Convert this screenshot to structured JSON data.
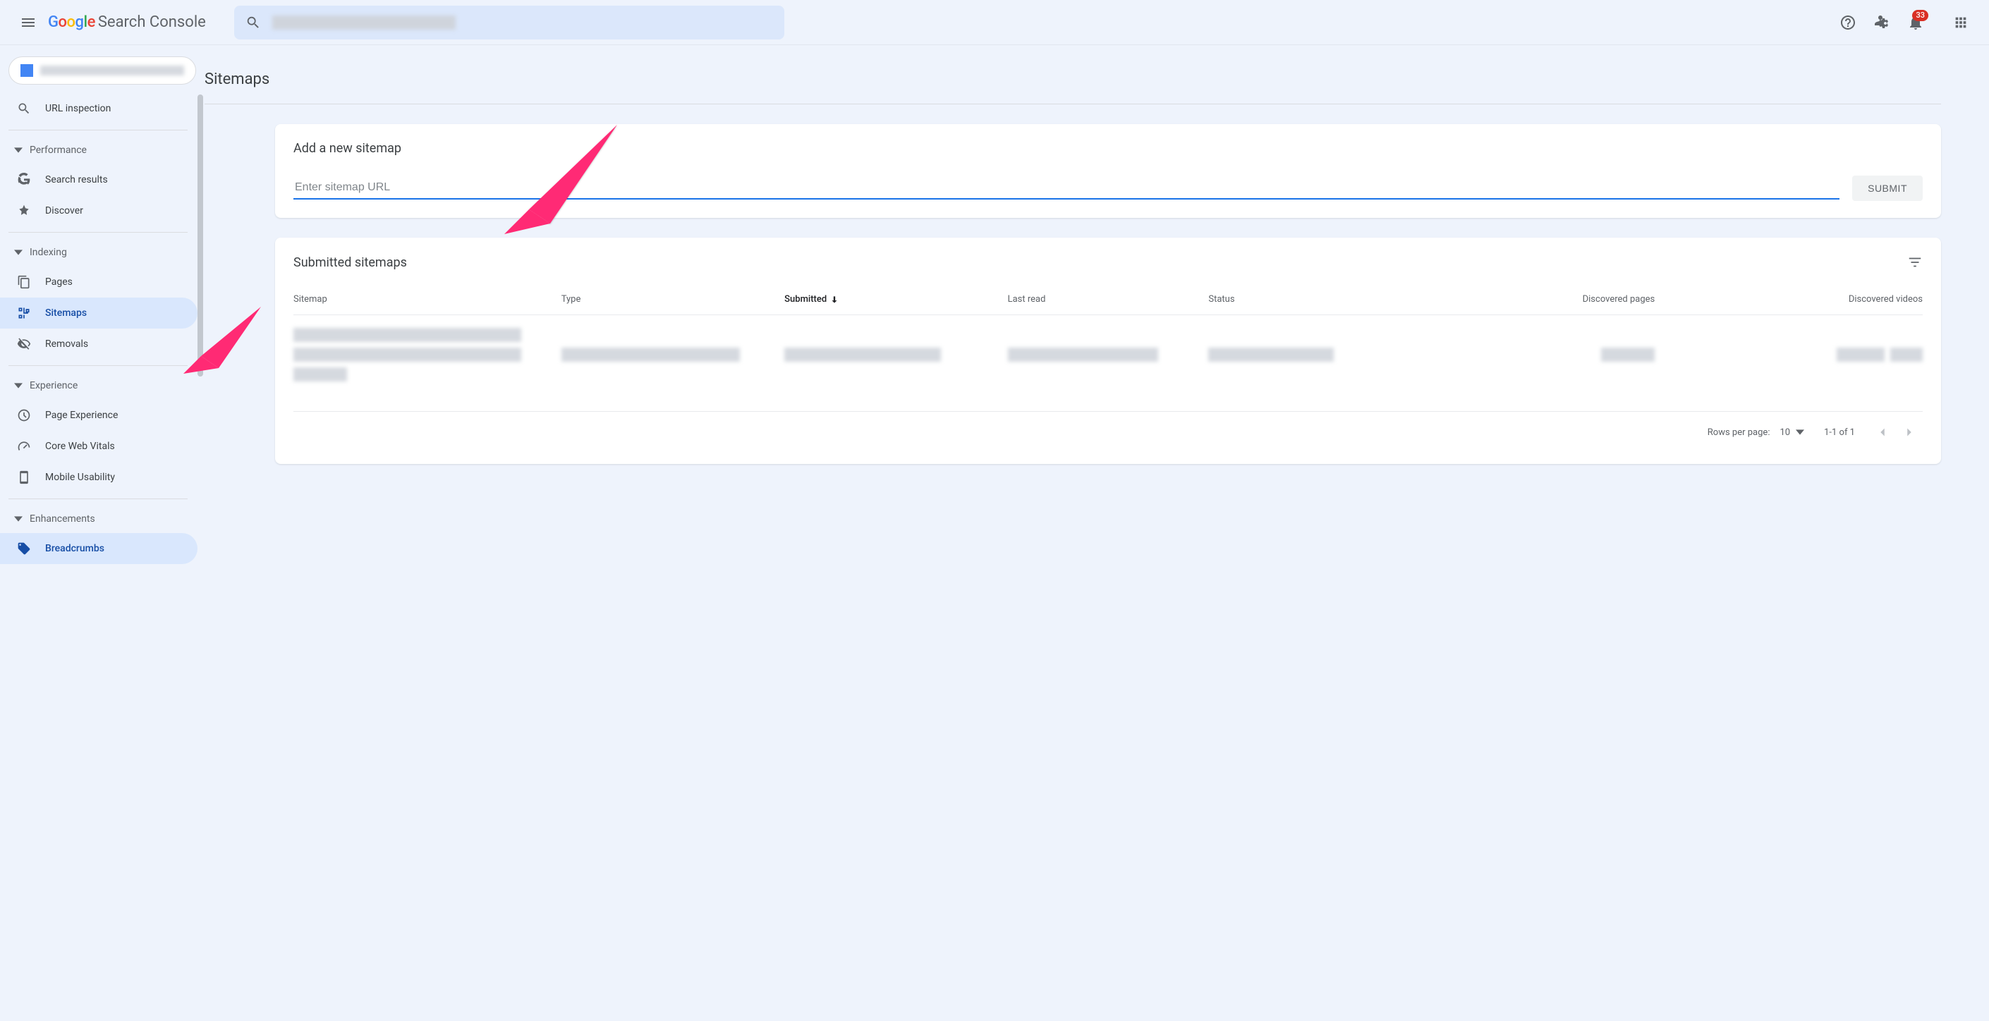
{
  "header": {
    "product_name": "Search Console",
    "notifications_count": "33"
  },
  "sidebar": {
    "url_inspection": "URL inspection",
    "groups": [
      {
        "label": "Performance",
        "items": [
          "Search results",
          "Discover"
        ]
      },
      {
        "label": "Indexing",
        "items": [
          "Pages",
          "Sitemaps",
          "Removals"
        ],
        "active": "Sitemaps"
      },
      {
        "label": "Experience",
        "items": [
          "Page Experience",
          "Core Web Vitals",
          "Mobile Usability"
        ]
      },
      {
        "label": "Enhancements",
        "items": [
          "Breadcrumbs"
        ]
      }
    ]
  },
  "page": {
    "title": "Sitemaps",
    "add_card_title": "Add a new sitemap",
    "url_placeholder": "Enter sitemap URL",
    "submit_label": "SUBMIT",
    "submitted_title": "Submitted sitemaps",
    "columns": [
      "Sitemap",
      "Type",
      "Submitted",
      "Last read",
      "Status",
      "Discovered pages",
      "Discovered videos"
    ],
    "rows_per_page_label": "Rows per page:",
    "rows_per_page_value": "10",
    "range_text": "1-1 of 1"
  }
}
